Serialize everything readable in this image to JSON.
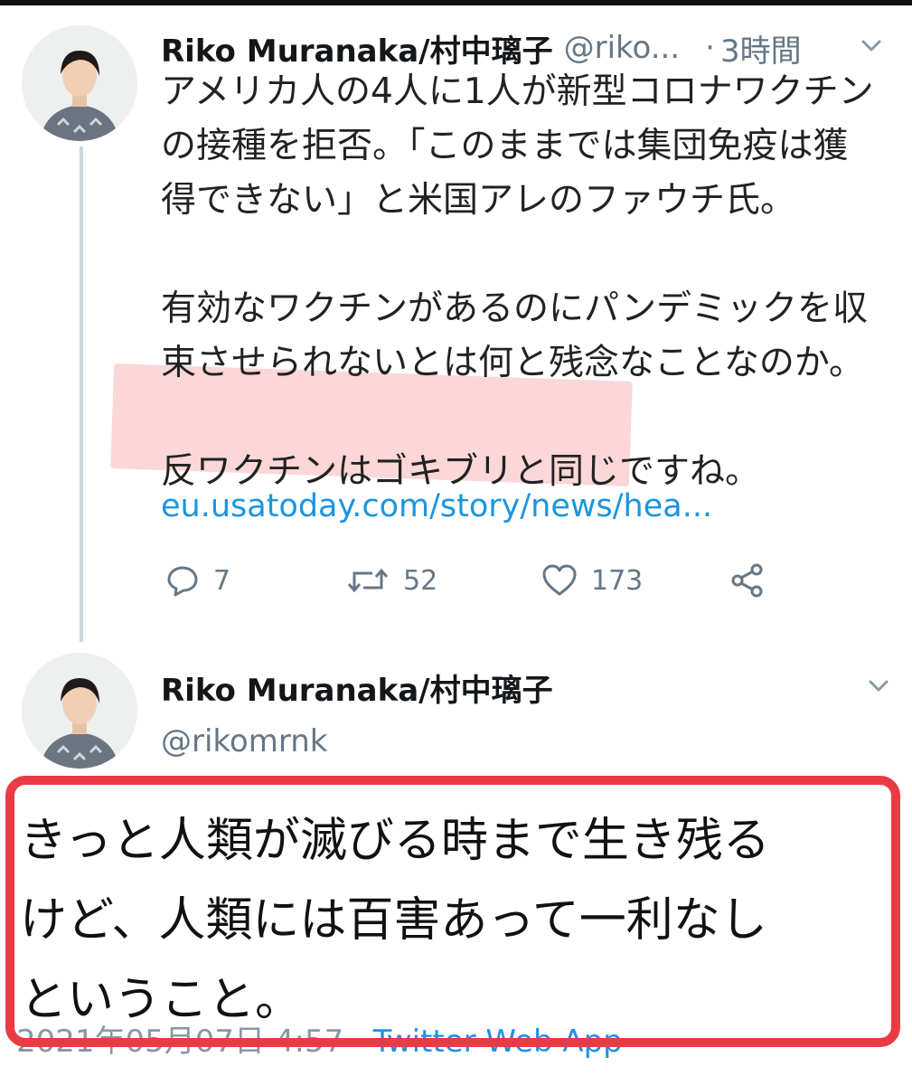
{
  "colors": {
    "accent": "#1b95e0",
    "annotation_box": "#ea3b44",
    "highlight": "#f7b6b8",
    "muted": "#657786"
  },
  "tweet1": {
    "display_name": "Riko Muranaka/村中璃子",
    "handle": "@riko...",
    "separator": "·",
    "time": "3時間",
    "paragraph1": [
      "アメリカ人の4人に1人が新型コロナワクチン",
      "の接種を拒否。「このままでは集団免疫は獲",
      "得できない」と米国アレのファウチ氏。"
    ],
    "paragraph2": [
      "有効なワクチンがあるのにパンデミックを収",
      "束させられないとは何と残念なことなのか。"
    ],
    "paragraph3": "反ワクチンはゴキブリと同じですね。",
    "link": "eu.usatoday.com/story/news/hea...",
    "reply_count": "7",
    "retweet_count": "52",
    "like_count": "173"
  },
  "tweet2": {
    "display_name": "Riko Muranaka/村中璃子",
    "handle": "@rikomrnk",
    "lines": [
      "きっと人類が滅びる時まで生き残る",
      "けど、人類には百害あって一利なし",
      "ということ。"
    ],
    "timestamp": "2021年05月07日 4:57 · ",
    "source_app": "Twitter Web App"
  },
  "icons": [
    "avatar-photo",
    "chevron-down-icon",
    "reply-icon",
    "retweet-icon",
    "like-icon",
    "share-icon"
  ]
}
